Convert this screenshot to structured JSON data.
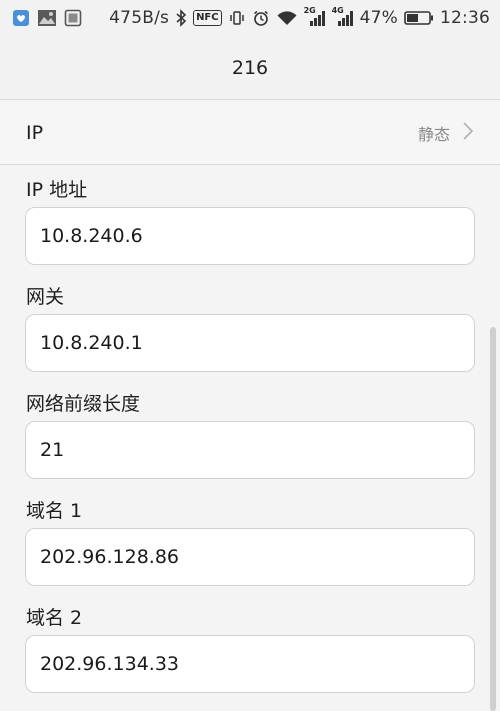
{
  "status_bar": {
    "network_speed": "475B/s",
    "nfc": "NFC",
    "signal1_type": "2G",
    "signal2_type": "4G",
    "battery": "47%",
    "time": "12:36"
  },
  "header": {
    "title": "216"
  },
  "ip_settings": {
    "label": "IP",
    "value": "静态"
  },
  "fields": [
    {
      "label": "IP 地址",
      "value": "10.8.240.6"
    },
    {
      "label": "网关",
      "value": "10.8.240.1"
    },
    {
      "label": "网络前缀长度",
      "value": "21"
    },
    {
      "label": "域名 1",
      "value": "202.96.128.86"
    },
    {
      "label": "域名 2",
      "value": "202.96.134.33"
    }
  ]
}
